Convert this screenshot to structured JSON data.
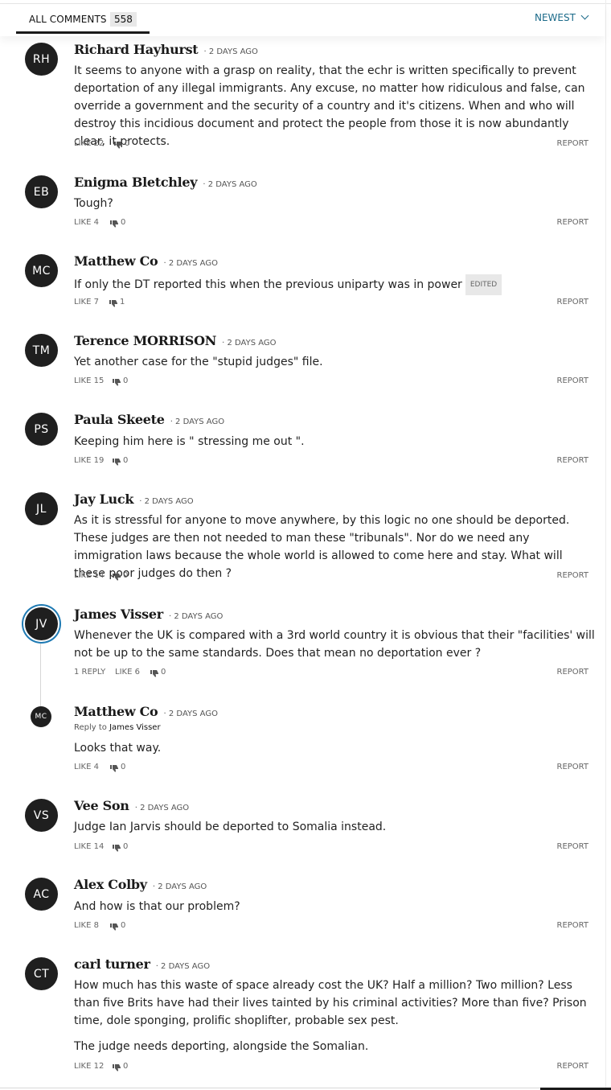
{
  "header": {
    "tab_label": "ALL COMMENTS",
    "count": "558",
    "sort_label": "NEWEST"
  },
  "labels": {
    "like": "LIKE",
    "report": "REPORT",
    "reply_to": "Reply to"
  },
  "comments": [
    {
      "initials": "RH",
      "name": "Richard Hayhurst",
      "time": "· 2 DAYS AGO",
      "text": [
        "It seems to anyone with a grasp on reality, that the echr is written specifically to prevent deportation of any illegal immigrants. Any excuse, no matter how ridiculous and false, can override a government and the security of a country and it's citizens. When and who will destroy this incidious document and protect the people from those it is now abundantly clear, it protects."
      ],
      "like": "LIKE 22",
      "dislikes": "0",
      "report": "REPORT"
    },
    {
      "initials": "EB",
      "name": "Enigma Bletchley",
      "time": "· 2 DAYS AGO",
      "text": [
        "Tough?"
      ],
      "like": "LIKE 4",
      "dislikes": "0",
      "report": "REPORT"
    },
    {
      "initials": "MC",
      "name": "Matthew Co",
      "time": "· 2 DAYS AGO",
      "text": [
        "If only the DT reported this when the previous uniparty was in power"
      ],
      "edited": "EDITED",
      "like": "LIKE 7",
      "dislikes": "1",
      "report": "REPORT"
    },
    {
      "initials": "TM",
      "name": "Terence MORRISON",
      "time": "· 2 DAYS AGO",
      "text": [
        "Yet another case for the \"stupid judges\" file."
      ],
      "like": "LIKE 15",
      "dislikes": "0",
      "report": "REPORT"
    },
    {
      "initials": "PS",
      "name": "Paula Skeete",
      "time": "· 2 DAYS AGO",
      "text": [
        "Keeping him here is \" stressing me out \"."
      ],
      "like": "LIKE 19",
      "dislikes": "0",
      "report": "REPORT"
    },
    {
      "initials": "JL",
      "name": "Jay Luck",
      "time": "· 2 DAYS AGO",
      "text": [
        "As it is stressful for anyone to move anywhere, by this logic no one should be deported. These judges are then not needed to man these \"tribunals\". Nor do we need any immigration laws because the whole world is allowed to come here and stay. What will these poor judges do then ?"
      ],
      "like": "LIKE 14",
      "dislikes": "0",
      "report": "REPORT"
    },
    {
      "initials": "JV",
      "name": "James Visser",
      "time": "· 2 DAYS AGO",
      "text": [
        "Whenever the UK is compared with a 3rd world country it is obvious that their \"facilities' will not be up to the same standards. Does that mean no deportation ever ?"
      ],
      "replies": "1 REPLY",
      "like": "LIKE 6",
      "dislikes": "0",
      "report": "REPORT"
    },
    {
      "initials": "MC",
      "name": "Matthew Co",
      "time": "· 2 DAYS AGO",
      "reply_to": "James Visser",
      "text": [
        "Looks that way."
      ],
      "like": "LIKE 4",
      "dislikes": "0",
      "report": "REPORT"
    },
    {
      "initials": "VS",
      "name": "Vee Son",
      "time": "· 2 DAYS AGO",
      "text": [
        "Judge Ian Jarvis should be deported to Somalia instead."
      ],
      "like": "LIKE 14",
      "dislikes": "0",
      "report": "REPORT"
    },
    {
      "initials": "AC",
      "name": "Alex Colby",
      "time": "· 2 DAYS AGO",
      "text": [
        "And how is that our problem?"
      ],
      "like": "LIKE 8",
      "dislikes": "0",
      "report": "REPORT"
    },
    {
      "initials": "CT",
      "name": "carl turner",
      "time": "· 2 DAYS AGO",
      "text": [
        "How much has this waste of space already cost the UK? Half a million? Two million? Less than five Brits have had their lives tainted by his criminal activities? More than five? Prison time, dole sponging, prolific shoplifter, probable sex pest.",
        "The judge needs deporting, alongside the Somalian."
      ],
      "like": "LIKE 12",
      "dislikes": "0",
      "report": "REPORT"
    }
  ]
}
